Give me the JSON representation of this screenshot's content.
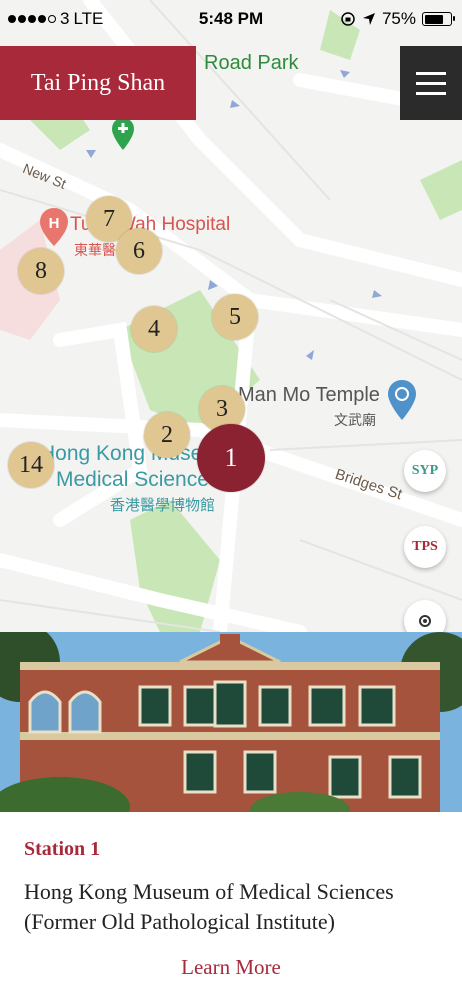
{
  "status_bar": {
    "carrier": "3",
    "network": "LTE",
    "time": "5:48 PM",
    "battery_percent": "75%",
    "battery_level": 0.75
  },
  "header": {
    "title": "Tai Ping Shan",
    "menu_icon": "hamburger-icon"
  },
  "map": {
    "labels": {
      "park": "Road Park",
      "new_st": "New St",
      "hospital": "Tung Wah Hospital",
      "hospital_zh": "東華醫",
      "temple": "Man Mo Temple",
      "temple_zh": "文武廟",
      "bridges": "Bridges St",
      "museum_line1": "Hong Kong Museum of",
      "museum_line2": "Medical Sciences",
      "museum_zh": "香港醫學博物館"
    },
    "markers": [
      "1",
      "2",
      "3",
      "4",
      "5",
      "6",
      "7",
      "8",
      "14"
    ],
    "active_marker": "1",
    "buttons": {
      "syp": "SYP",
      "tps": "TPS",
      "locate_icon": "locate-icon"
    }
  },
  "station": {
    "label": "Station 1",
    "name": "Hong Kong Museum of Medical Sciences (Former Old Pathological Institute)",
    "learn_more": "Learn More"
  },
  "colors": {
    "brand_red": "#a8293a",
    "active_marker": "#8b2232",
    "marker": "#e0c691",
    "menu_bg": "#2b2b2b",
    "syp_green": "#3c9a8a"
  }
}
